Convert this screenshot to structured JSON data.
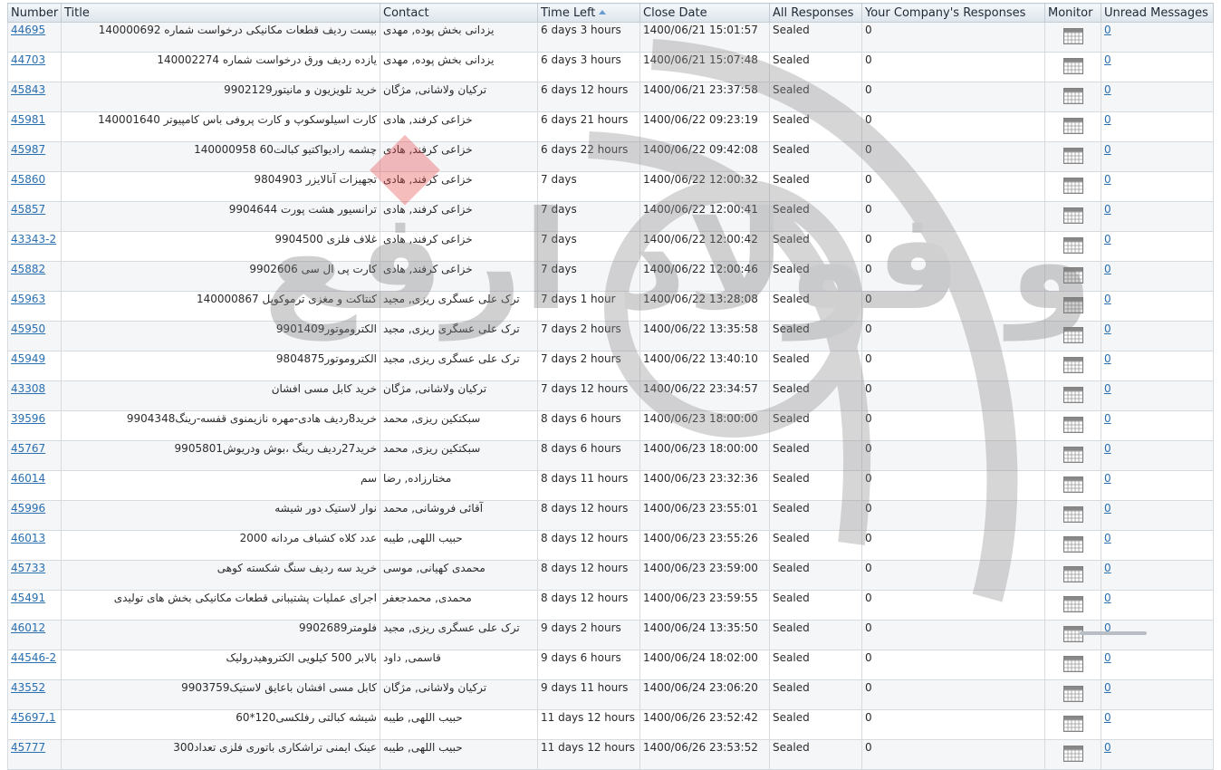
{
  "columns": {
    "number": "Number",
    "title": "Title",
    "contact": "Contact",
    "time_left": "Time Left",
    "close_date": "Close Date",
    "all_responses": "All Responses",
    "company_responses": "Your Company's Responses",
    "monitor": "Monitor",
    "unread": "Unread Messages"
  },
  "rows": [
    {
      "number": "44695",
      "title": "بیست ردیف قطعات مکانیکی درخواست شماره 140000692",
      "contact": "یزدانی بخش پوده, مهدی",
      "time_left": "6 days 3 hours",
      "close_date": "1400/06/21 15:01:57",
      "all_responses": "Sealed",
      "company_responses": "0",
      "unread": "0"
    },
    {
      "number": "44703",
      "title": "یازده ردیف ورق درخواست شماره 140002274",
      "contact": "یزدانی بخش پوده, مهدی",
      "time_left": "6 days 3 hours",
      "close_date": "1400/06/21 15:07:48",
      "all_responses": "Sealed",
      "company_responses": "0",
      "unread": "0"
    },
    {
      "number": "45843",
      "title": "خرید تلویزیون و مانیتور9902129",
      "contact": "ترکیان ولاشانی, مژگان",
      "time_left": "6 days 12 hours",
      "close_date": "1400/06/21 23:37:58",
      "all_responses": "Sealed",
      "company_responses": "0",
      "unread": "0"
    },
    {
      "number": "45981",
      "title": "کارت اسیلوسکوپ و کارت پروفی باس کامپیوتر 140001640",
      "contact": "خزاعی کرفند, هادی",
      "time_left": "6 days 21 hours",
      "close_date": "1400/06/22 09:23:19",
      "all_responses": "Sealed",
      "company_responses": "0",
      "unread": "0"
    },
    {
      "number": "45987",
      "title": "چشمه رادیواکتیو کبالت60 140000958",
      "contact": "خزاعی کرفند, هادی",
      "time_left": "6 days 22 hours",
      "close_date": "1400/06/22 09:42:08",
      "all_responses": "Sealed",
      "company_responses": "0",
      "unread": "0"
    },
    {
      "number": "45860",
      "title": "تجهیزات آنالایزر 9804903",
      "contact": "خزاعی کرفند, هادی",
      "time_left": "7 days",
      "close_date": "1400/06/22 12:00:32",
      "all_responses": "Sealed",
      "company_responses": "0",
      "unread": "0"
    },
    {
      "number": "45857",
      "title": "ترانسیور هشت پورت 9904644",
      "contact": "خزاعی کرفند, هادی",
      "time_left": "7 days",
      "close_date": "1400/06/22 12:00:41",
      "all_responses": "Sealed",
      "company_responses": "0",
      "unread": "0"
    },
    {
      "number": "43343-2",
      "title": "غلاف فلزی 9904500",
      "contact": "خزاعی کرفند, هادی",
      "time_left": "7 days",
      "close_date": "1400/06/22 12:00:42",
      "all_responses": "Sealed",
      "company_responses": "0",
      "unread": "0"
    },
    {
      "number": "45882",
      "title": "کارت پی ال سی 9902606",
      "contact": "خزاعی کرفند, هادی",
      "time_left": "7 days",
      "close_date": "1400/06/22 12:00:46",
      "all_responses": "Sealed",
      "company_responses": "0",
      "unread": "0"
    },
    {
      "number": "45963",
      "title": "کنتاکت و مغزی ترموکوپل 140000867",
      "contact": "ترک علی عسگری ریزی, مجید",
      "time_left": "7 days 1 hour",
      "close_date": "1400/06/22 13:28:08",
      "all_responses": "Sealed",
      "company_responses": "0",
      "unread": "0"
    },
    {
      "number": "45950",
      "title": "الکتروموتور9901409",
      "contact": "ترک علی عسگری ریزی, مجید",
      "time_left": "7 days 2 hours",
      "close_date": "1400/06/22 13:35:58",
      "all_responses": "Sealed",
      "company_responses": "0",
      "unread": "0"
    },
    {
      "number": "45949",
      "title": "الکتروموتور9804875",
      "contact": "ترک علی عسگری ریزی, مجید",
      "time_left": "7 days 2 hours",
      "close_date": "1400/06/22 13:40:10",
      "all_responses": "Sealed",
      "company_responses": "0",
      "unread": "0"
    },
    {
      "number": "43308",
      "title": "خرید کابل مسی افشان",
      "contact": "ترکیان ولاشانی, مژگان",
      "time_left": "7 days 12 hours",
      "close_date": "1400/06/22 23:34:57",
      "all_responses": "Sealed",
      "company_responses": "0",
      "unread": "0"
    },
    {
      "number": "39596",
      "title": "خرید8ردیف هادی-مهره نازیمنوی قفسه-رینگ9904348",
      "contact": "سبکتکین ریزی, محمد",
      "time_left": "8 days 6 hours",
      "close_date": "1400/06/23 18:00:00",
      "all_responses": "Sealed",
      "company_responses": "0",
      "unread": "0"
    },
    {
      "number": "45767",
      "title": "خرید27ردیف رینگ ،بوش ودریوش9905801",
      "contact": "سبکتکین ریزی, محمد",
      "time_left": "8 days 6 hours",
      "close_date": "1400/06/23 18:00:00",
      "all_responses": "Sealed",
      "company_responses": "0",
      "unread": "0"
    },
    {
      "number": "46014",
      "title": "سم",
      "contact": "مختارزاده, رضا",
      "time_left": "8 days 11 hours",
      "close_date": "1400/06/23 23:32:36",
      "all_responses": "Sealed",
      "company_responses": "0",
      "unread": "0"
    },
    {
      "number": "45996",
      "title": "نوار لاستیک دور شیشه",
      "contact": "آقائی فروشانی, محمد",
      "time_left": "8 days 12 hours",
      "close_date": "1400/06/23 23:55:01",
      "all_responses": "Sealed",
      "company_responses": "0",
      "unread": "0"
    },
    {
      "number": "46013",
      "title": "عدد کلاه کشباف مردانه 2000",
      "contact": "حبیب اللهی, طیبه",
      "time_left": "8 days 12 hours",
      "close_date": "1400/06/23 23:55:26",
      "all_responses": "Sealed",
      "company_responses": "0",
      "unread": "0"
    },
    {
      "number": "45733",
      "title": "خرید سه ردیف سنگ شکسته کوهی",
      "contact": "محمدی کهیانی, موسی",
      "time_left": "8 days 12 hours",
      "close_date": "1400/06/23 23:59:00",
      "all_responses": "Sealed",
      "company_responses": "0",
      "unread": "0"
    },
    {
      "number": "45491",
      "title": "اجرای عملیات پشتیبانی قطعات مکانیکی بخش های تولیدی",
      "contact": "محمدی, محمدجعفر",
      "time_left": "8 days 12 hours",
      "close_date": "1400/06/23 23:59:55",
      "all_responses": "Sealed",
      "company_responses": "0",
      "unread": "0"
    },
    {
      "number": "46012",
      "title": "فلومتر9902689",
      "contact": "ترک علی عسگری ریزی, مجید",
      "time_left": "9 days 2 hours",
      "close_date": "1400/06/24 13:35:50",
      "all_responses": "Sealed",
      "company_responses": "0",
      "unread": "0"
    },
    {
      "number": "44546-2",
      "title": "بالابر 500 کیلویی الکتروهیدرولیک",
      "contact": "قاسمی, داود",
      "time_left": "9 days 6 hours",
      "close_date": "1400/06/24 18:02:00",
      "all_responses": "Sealed",
      "company_responses": "0",
      "unread": "0"
    },
    {
      "number": "43552",
      "title": "کابل مسی افشان باعایق لاستیک9903759",
      "contact": "ترکیان ولاشانی, مژگان",
      "time_left": "9 days 11 hours",
      "close_date": "1400/06/24 23:06:20",
      "all_responses": "Sealed",
      "company_responses": "0",
      "unread": "0"
    },
    {
      "number": "45697,1",
      "title": "شیشه کبالتی رفلکسی120*60",
      "contact": "حبیب اللهی, طیبه",
      "time_left": "11 days 12 hours",
      "close_date": "1400/06/26 23:52:42",
      "all_responses": "Sealed",
      "company_responses": "0",
      "unread": "0"
    },
    {
      "number": "45777",
      "title": "عینک ایمنی تراشکاری باتوری فلزی تعداد300",
      "contact": "حبیب اللهی, طیبه",
      "time_left": "11 days 12 hours",
      "close_date": "1400/06/26 23:53:52",
      "all_responses": "Sealed",
      "company_responses": "0",
      "unread": "0"
    }
  ],
  "watermark_text": "آهن و فولاد ارفع",
  "icons": {
    "monitor": "calendar-grid-icon",
    "sort": "sort-ascending-icon"
  },
  "colors": {
    "link": "#2a6fb0",
    "header_bg": "#dde5ec",
    "watermark": "#9a9a9a"
  }
}
